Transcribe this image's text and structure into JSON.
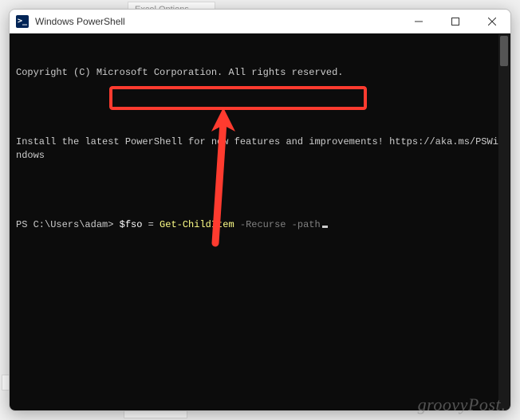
{
  "background": {
    "top_fragment": "Excel Options",
    "bottom_fragment": "",
    "left_fragment": "E!"
  },
  "titlebar": {
    "icon_glyph": ">_",
    "title": "Windows PowerShell"
  },
  "window_controls": {
    "minimize": "minimize",
    "maximize": "maximize",
    "close": "close"
  },
  "terminal": {
    "line1": "Copyright (C) Microsoft Corporation. All rights reserved.",
    "line2": "",
    "line3": "Install the latest PowerShell for new features and improvements! https://aka.ms/PSWindows",
    "line4": "",
    "prompt": "PS C:\\Users\\adam> ",
    "cmd_var": "$fso",
    "cmd_eq": " = ",
    "cmd_cmdlet": "Get-ChildItem",
    "cmd_param1": " -Recurse",
    "cmd_param2": " -path"
  },
  "annotation": {
    "highlight_color": "#ff3b2f",
    "arrow_color": "#ff3b2f"
  },
  "watermark": {
    "text_main": "groovy",
    "text_sub": "Post",
    "text_dot": "."
  }
}
